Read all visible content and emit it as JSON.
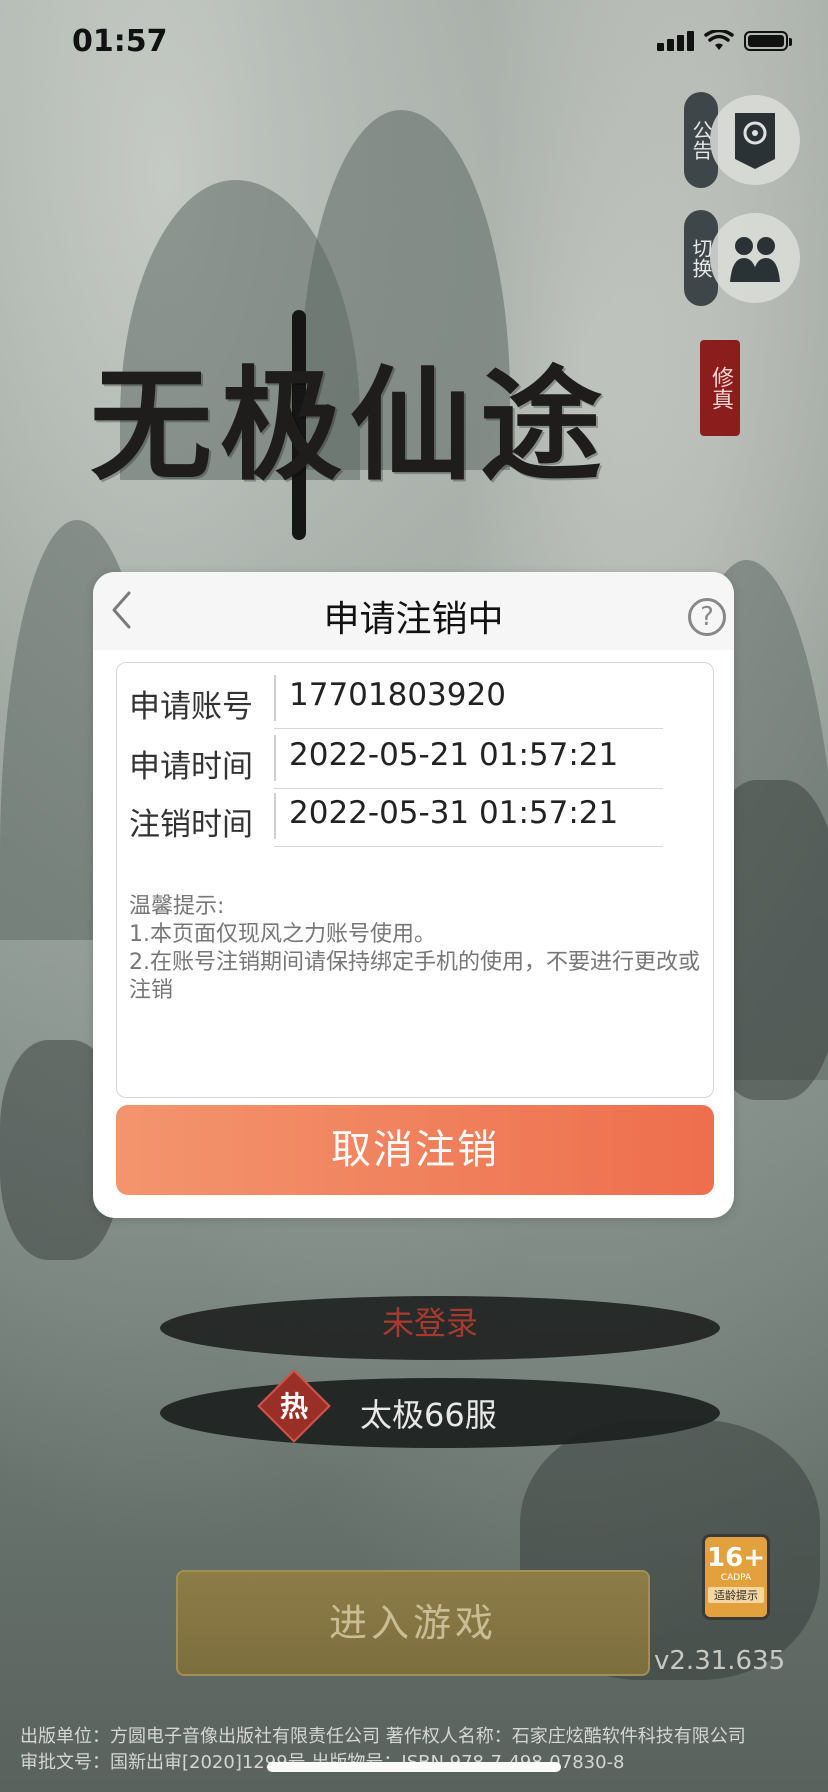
{
  "status_bar": {
    "time": "01:57"
  },
  "side_buttons": {
    "announcement_label": "公告",
    "switch_label": "切换"
  },
  "logo": {
    "title": "无极仙途",
    "seal": "修真"
  },
  "dialog": {
    "title": "申请注销中",
    "rows": [
      {
        "label": "申请账号",
        "value": "17701803920"
      },
      {
        "label": "申请时间",
        "value": "2022-05-21 01:57:21"
      },
      {
        "label": "注销时间",
        "value": "2022-05-31 01:57:21"
      }
    ],
    "tips": {
      "heading": "温馨提示:",
      "line1": "1.本页面仅现风之力账号使用。",
      "line2": "2.在账号注销期间请保持绑定手机的使用，不要进行更改或注销"
    },
    "cancel_button": "取消注销"
  },
  "login": {
    "status": "未登录",
    "hot_label": "热",
    "server": "太极66服",
    "enter_button": "进入游戏"
  },
  "age_rating": {
    "age": "16+",
    "org": "CADPA",
    "tip": "适龄提示"
  },
  "version": "v2.31.635",
  "footer": {
    "line1": "出版单位：方圆电子音像出版社有限责任公司  著作权人名称：石家庄炫酷软件科技有限公司",
    "line2": "审批文号：国新出审[2020]1299号          出版物号：ISBN 978-7-498-07830-8"
  },
  "colors": {
    "cancel_button_start": "#f3956e",
    "cancel_button_end": "#ee6e4d",
    "not_logged_red": "#a63a2d",
    "enter_button_gold": "#8c7d48"
  }
}
